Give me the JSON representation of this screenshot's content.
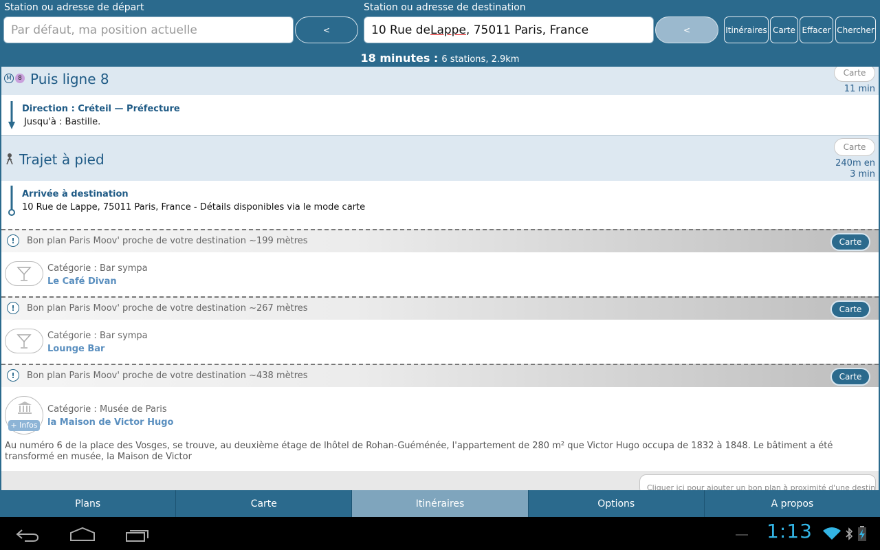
{
  "header": {
    "start_label": "Station ou adresse de départ",
    "start_placeholder": "Par défaut, ma position actuelle",
    "swap_left": "<",
    "dest_label": "Station ou adresse de destination",
    "dest_value_pre": "10 Rue de ",
    "dest_value_ul": "Lappe",
    "dest_value_post": ", 75011 Paris, France",
    "swap_right": "<",
    "buttons": [
      "Itinéraires",
      "Carte",
      "Effacer",
      "Chercher"
    ],
    "summary_big": "18 minutes :",
    "summary_small": "6 stations, 2.9km"
  },
  "route": {
    "metro": {
      "badge_m": "M",
      "badge_line": "8",
      "title": "Puis ligne 8",
      "carte": "Carte",
      "duration": "11 min",
      "direction": "Direction : Créteil — Préfecture",
      "until": "Jusqu'à : Bastille."
    },
    "walk": {
      "title": "Trajet à pied",
      "carte": "Carte",
      "duration_line1": "240m en",
      "duration_line2": "3 min",
      "arrival_title": "Arrivée à destination",
      "arrival_text": "10 Rue de Lappe, 75011 Paris, France - Détails disponibles via le mode carte"
    }
  },
  "tips": [
    {
      "band": "Bon plan Paris Moov' proche de votre destination ~199 mètres",
      "carte": "Carte",
      "category": "Catégorie : Bar sympa",
      "name": "Le Café Divan",
      "icon": "cocktail-icon"
    },
    {
      "band": "Bon plan Paris Moov' proche de votre destination ~267 mètres",
      "carte": "Carte",
      "category": "Catégorie : Bar sympa",
      "name": "Lounge Bar",
      "icon": "cocktail-icon"
    },
    {
      "band": "Bon plan Paris Moov' proche de votre destination ~438 mètres",
      "carte": "Carte",
      "category": "Catégorie : Musée de Paris",
      "name": "la Maison de Victor Hugo",
      "icon": "museum-icon",
      "infos": "+ Infos",
      "description": "Au numéro 6 de la place des Vosges, se trouve, au deuxième étage de lhôtel de Rohan-Guéménée, l'appartement de 280 m² que Victor Hugo occupa de 1832 à 1848. Le bâtiment a été transformé en musée, la Maison de Victor"
    }
  ],
  "add_tip": "Cliquer ici pour ajouter un bon plan à proximité d'une destination",
  "tabs": [
    {
      "label": "Plans",
      "active": false
    },
    {
      "label": "Carte",
      "active": false
    },
    {
      "label": "Itinéraires",
      "active": true
    },
    {
      "label": "Options",
      "active": false
    },
    {
      "label": "A propos",
      "active": false
    }
  ],
  "system": {
    "clock": "1:13"
  },
  "colors": {
    "primary": "#2b6a8d",
    "section_bg": "#dde8f1",
    "title_blue": "#1e5a85",
    "link_blue": "#5a8fbf",
    "clock": "#33b5e5"
  }
}
